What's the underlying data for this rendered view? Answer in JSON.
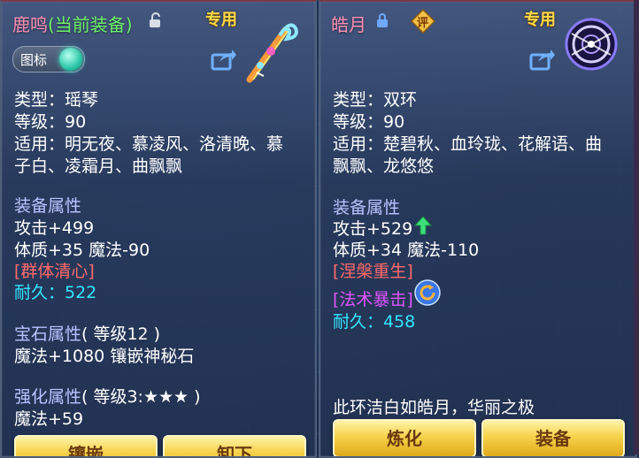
{
  "left": {
    "name": "鹿鸣",
    "current_tag": "(当前装备)",
    "exclusive": "专用",
    "icon_toggle_label": "图标",
    "icon_toggle_on": true,
    "type_line": "类型：瑶琴",
    "level_line": "等级：90",
    "applies_line1": "适用：明无夜、慕凌风、洛清晚、慕",
    "applies_line2": "子白、凌霜月、曲飘飘",
    "attr_header": "装备属性",
    "attr_line1": "攻击+499",
    "attr_line2": "体质+35 魔法-90",
    "special": "[群体清心]",
    "durability": "耐久：522",
    "gem_header": "宝石属性",
    "gem_level": "( 等级12 )",
    "gem_line": "魔法+1080 镶嵌神秘石",
    "enhance_header": "强化属性",
    "enhance_level": "( 等级3:★★★ )",
    "enhance_line": "魔法+59",
    "buttons": [
      "镶嵌",
      "卸下"
    ]
  },
  "right": {
    "name": "皓月",
    "exclusive": "专用",
    "eval_label": "评",
    "type_line": "类型：双环",
    "level_line": "等级：90",
    "applies_line1": "适用：楚碧秋、血玲珑、花解语、曲",
    "applies_line2": "飘飘、龙悠悠",
    "attr_header": "装备属性",
    "attr_line1": "攻击+529",
    "attr_line2": "体质+34 魔法-110",
    "special1": "[涅槃重生]",
    "special2": "[法术暴击]",
    "durability": "耐久：458",
    "description": "此环洁白如皓月，华丽之极",
    "buttons": [
      "炼化",
      "装备"
    ]
  },
  "colors": {
    "name": "#ff8fb4",
    "current_tag": "#6ef06a",
    "section": "#b8c4ff",
    "special_red": "#ff6a6a",
    "durability": "#33e6ff",
    "special_magenta": "#e055ff",
    "exclusive": "#ffd84a"
  }
}
